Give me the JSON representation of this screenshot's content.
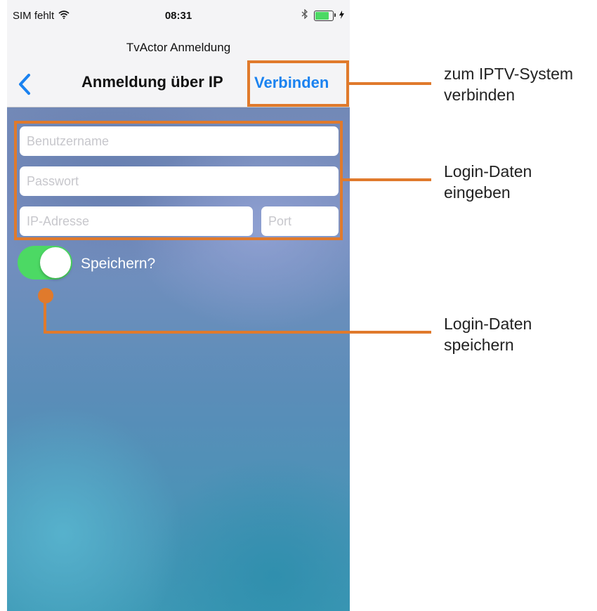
{
  "status_bar": {
    "carrier": "SIM fehlt",
    "time": "08:31",
    "wifi_icon": "wifi-icon",
    "bluetooth_icon": "bluetooth-icon",
    "battery_icon": "battery-icon",
    "battery_level": 0.8
  },
  "navbar": {
    "subtitle": "TvActor Anmeldung",
    "title": "Anmeldung über IP",
    "connect_label": "Verbinden",
    "back_icon": "chevron-left-icon"
  },
  "form": {
    "username_placeholder": "Benutzername",
    "password_placeholder": "Passwort",
    "ip_placeholder": "IP-Adresse",
    "port_placeholder": "Port",
    "save_label": "Speichern?",
    "save_enabled": true
  },
  "annotations": {
    "connect_line1": "zum IPTV-System",
    "connect_line2": "verbinden",
    "login_line1": "Login-Daten",
    "login_line2": "eingeben",
    "save_line1": "Login-Daten",
    "save_line2": "speichern"
  },
  "colors": {
    "accent": "#1a82f0",
    "callout": "#e07a2c",
    "toggle_on": "#4cd964"
  }
}
